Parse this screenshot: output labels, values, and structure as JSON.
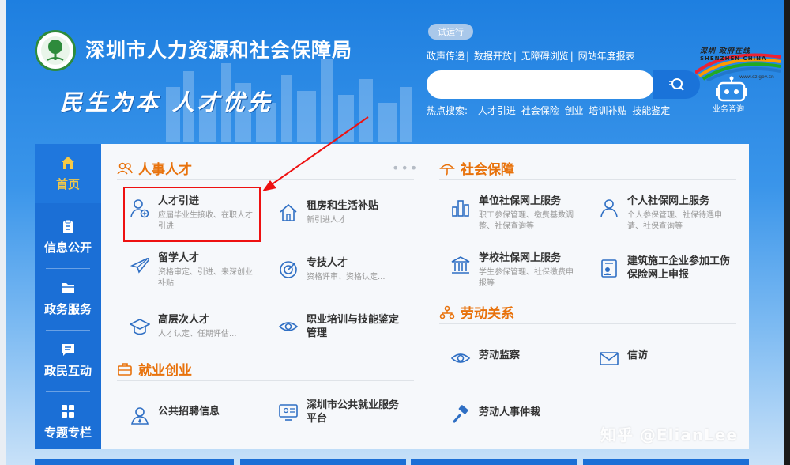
{
  "header": {
    "site_title": "深圳市人力资源和社会保障局",
    "slogan": "民生为本 人才优先",
    "trial_badge": "试运行",
    "top_links": [
      "政声传递",
      "数据开放",
      "无障碍浏览",
      "网站年度报表"
    ],
    "search": {
      "placeholder": "",
      "button_icon": "search-icon"
    },
    "hot_search_label": "热点搜索:",
    "hot_search_terms": [
      "人才引进",
      "社会保险",
      "创业",
      "培训补贴",
      "技能鉴定"
    ],
    "consult_label": "业务咨询",
    "sz_logo_text": "深圳 政府在线",
    "sz_logo_en": "SHENZHEN CHINA",
    "sz_url": "www.sz.gov.cn"
  },
  "sidebar": {
    "items": [
      {
        "label": "首页",
        "icon": "home-icon",
        "active": true
      },
      {
        "label": "信息公开",
        "icon": "clipboard-icon",
        "active": false
      },
      {
        "label": "政务服务",
        "icon": "folder-icon",
        "active": false
      },
      {
        "label": "政民互动",
        "icon": "chat-icon",
        "active": false
      },
      {
        "label": "专题专栏",
        "icon": "grid-icon",
        "active": false
      }
    ]
  },
  "sections": {
    "talent": {
      "title": "人事人才",
      "icon": "people-icon",
      "items": [
        {
          "name": "人才引进",
          "desc": "应届毕业生接收、在职人才引进",
          "icon": "user-plus-icon"
        },
        {
          "name": "租房和生活补贴",
          "desc": "新引进人才",
          "icon": "house-icon"
        },
        {
          "name": "留学人才",
          "desc": "资格审定、引进、来深创业补贴",
          "icon": "airplane-icon"
        },
        {
          "name": "专技人才",
          "desc": "资格评审、资格认定...",
          "icon": "target-icon"
        },
        {
          "name": "高层次人才",
          "desc": "人才认定、任期评估...",
          "icon": "graduation-cap-icon"
        },
        {
          "name": "职业培训与技能鉴定管理",
          "desc": "",
          "icon": "eye-icon"
        }
      ]
    },
    "employment": {
      "title": "就业创业",
      "icon": "briefcase-icon",
      "items": [
        {
          "name": "公共招聘信息",
          "icon": "user-badge-icon"
        },
        {
          "name": "深圳市公共就业服务平台",
          "icon": "monitor-icon"
        }
      ]
    },
    "social_security": {
      "title": "社会保障",
      "icon": "umbrella-icon",
      "items": [
        {
          "name": "单位社保网上服务",
          "desc": "职工参保管理、缴费基数调整、社保查询等",
          "icon": "building-chart-icon"
        },
        {
          "name": "个人社保网上服务",
          "desc": "个人参保管理、社保待遇申请、社保查询等",
          "icon": "person-icon"
        },
        {
          "name": "学校社保网上服务",
          "desc": "学生参保管理、社保缴费申报等",
          "icon": "school-icon"
        },
        {
          "name": "建筑施工企业参加工伤保险网上申报",
          "desc": "",
          "icon": "id-card-icon"
        }
      ]
    },
    "labor": {
      "title": "劳动关系",
      "icon": "org-chart-icon",
      "items": [
        {
          "name": "劳动监察",
          "icon": "eye-icon"
        },
        {
          "name": "信访",
          "icon": "envelope-icon"
        },
        {
          "name": "劳动人事仲裁",
          "icon": "gavel-icon"
        }
      ]
    }
  },
  "watermark": "知乎 @ElianLee",
  "colors": {
    "primary_blue": "#1b6fd6",
    "accent_orange": "#e8720c",
    "highlight_red": "#e11111"
  }
}
